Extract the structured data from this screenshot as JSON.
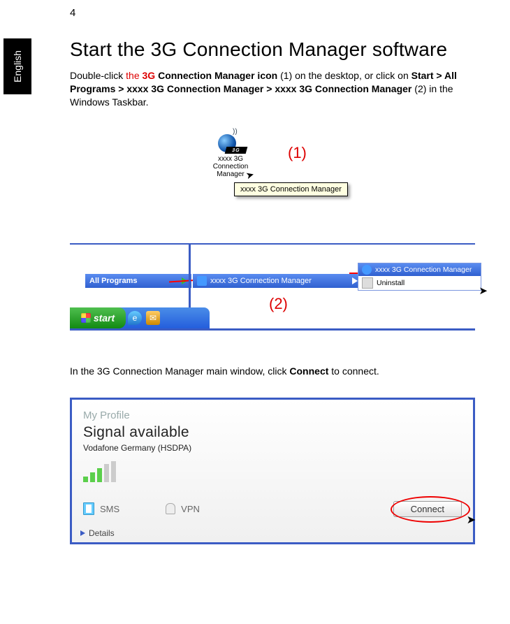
{
  "page_number": "4",
  "language_tab": "English",
  "heading": "Start the 3G Connection Manager software",
  "intro": {
    "t1": "Double-click ",
    "link": "the ",
    "link_bold": "3G ",
    "t2_bold": "Connection Manager icon",
    "t3": " (1) on the desktop, or click on ",
    "path_bold": "Start > All Programs > xxxx 3G Connection Manager > xxxx 3G Connection Manager",
    "t4": " (2) in the Windows Taskbar."
  },
  "fig1": {
    "icon_label_l1": "xxxx 3G",
    "icon_label_l2": "Connection",
    "icon_label_l3": "Manager",
    "tooltip": "xxxx 3G Connection Manager",
    "callout": "(1)",
    "badge_3g": "3G"
  },
  "fig2": {
    "start_label": "start",
    "all_programs": "All Programs",
    "folder": "xxxx 3G Connection Manager",
    "sub_selected": "xxxx 3G Connection Manager",
    "sub_uninstall": "Uninstall",
    "callout": "(2)"
  },
  "para2": {
    "t1": "In the 3G Connection Manager main window, click ",
    "bold": "Connect",
    "t2": " to connect."
  },
  "fig3": {
    "my_profile": "My Profile",
    "signal": "Signal available",
    "carrier": "Vodafone Germany (HSDPA)",
    "sms": "SMS",
    "vpn": "VPN",
    "connect": "Connect",
    "details": "Details"
  }
}
